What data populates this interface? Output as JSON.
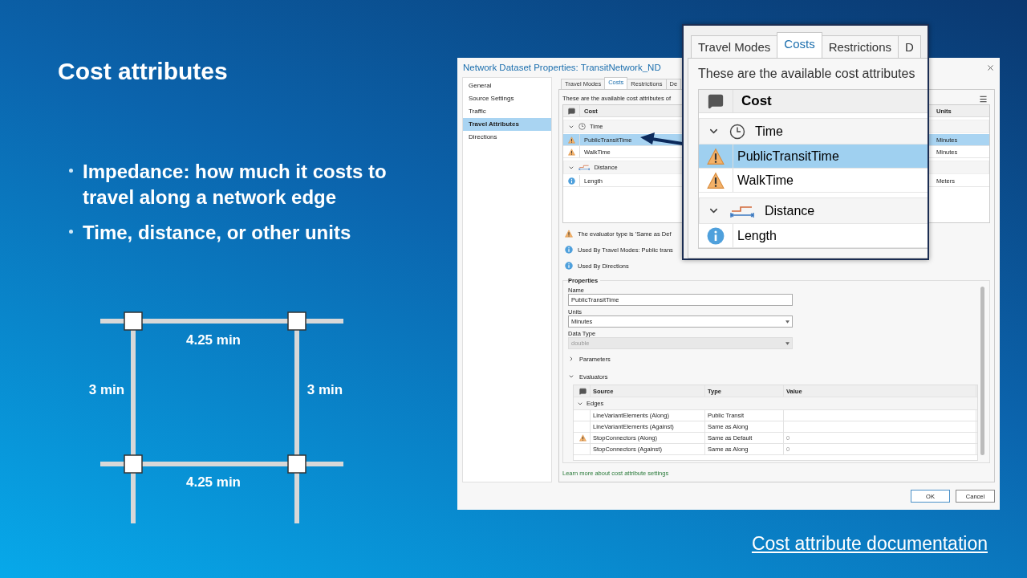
{
  "slide": {
    "title": "Cost attributes",
    "bullets": [
      "Impedance: how much it costs to travel along a network edge",
      "Time, distance, or other units"
    ],
    "diagram": {
      "edge_labels": [
        "4.25 min",
        "3 min",
        "3 min",
        "4.25 min"
      ]
    },
    "link": "Cost attribute documentation"
  },
  "dialog": {
    "title": "Network Dataset Properties: TransitNetwork_ND",
    "sidebar": [
      {
        "label": "General",
        "selected": false
      },
      {
        "label": "Source Settings",
        "selected": false
      },
      {
        "label": "Traffic",
        "selected": false
      },
      {
        "label": "Travel Attributes",
        "selected": true
      },
      {
        "label": "Directions",
        "selected": false
      }
    ],
    "tabs": [
      {
        "label": "Travel Modes",
        "selected": false
      },
      {
        "label": "Costs",
        "selected": true
      },
      {
        "label": "Restrictions",
        "selected": false
      },
      {
        "label": "De",
        "selected": false
      }
    ],
    "description": "These are the available cost attributes of",
    "cost_table": {
      "columns": [
        "Cost",
        "Units"
      ],
      "groups": [
        {
          "label": "Time",
          "kind": "time",
          "expanded": true,
          "rows": [
            {
              "name": "PublicTransitTime",
              "kind": "warning",
              "units": "Minutes",
              "selected": true
            },
            {
              "name": "WalkTime",
              "kind": "warning",
              "units": "Minutes",
              "selected": false
            }
          ]
        },
        {
          "label": "Distance",
          "kind": "distance",
          "expanded": true,
          "rows": [
            {
              "name": "Length",
              "kind": "info",
              "units": "Meters",
              "selected": false
            }
          ]
        }
      ]
    },
    "messages": [
      {
        "kind": "warning",
        "text": "The evaluator type is 'Same as Def"
      },
      {
        "kind": "info",
        "text": "Used By Travel Modes: Public trans"
      },
      {
        "kind": "info",
        "text": "Used By Directions"
      }
    ],
    "properties": {
      "legend": "Properties",
      "fields": [
        {
          "label": "Name",
          "kind": "text",
          "value": "PublicTransitTime",
          "disabled": false
        },
        {
          "label": "Units",
          "kind": "select",
          "value": "Minutes",
          "disabled": false
        },
        {
          "label": "Data Type",
          "kind": "select",
          "value": "double",
          "disabled": true
        }
      ],
      "sections": [
        {
          "label": "Parameters",
          "expanded": false
        },
        {
          "label": "Evaluators",
          "expanded": true
        }
      ],
      "evaluators": {
        "columns": [
          "Source",
          "Type",
          "Value"
        ],
        "group": {
          "label": "Edges",
          "expanded": true
        },
        "rows": [
          {
            "source": "LineVariantElements (Along)",
            "type": "Public Transit",
            "value": "",
            "warning": false
          },
          {
            "source": "LineVariantElements (Against)",
            "type": "Same as Along",
            "value": "",
            "warning": false
          },
          {
            "source": "StopConnectors (Along)",
            "type": "Same as Default",
            "value": "0",
            "warning": true
          },
          {
            "source": "StopConnectors (Against)",
            "type": "Same as Along",
            "value": "0",
            "warning": false
          }
        ]
      }
    },
    "link": "Learn more about cost attribute settings",
    "buttons": [
      "OK",
      "Cancel"
    ]
  },
  "inset": {
    "tabs": [
      {
        "label": "Travel Modes",
        "selected": false
      },
      {
        "label": "Costs",
        "selected": true
      },
      {
        "label": "Restrictions",
        "selected": false
      },
      {
        "label": "D",
        "selected": false
      }
    ],
    "description": "These are the available cost attributes",
    "column": "Cost",
    "groups": [
      {
        "label": "Time",
        "kind": "time",
        "expanded": true,
        "rows": [
          {
            "name": "PublicTransitTime",
            "kind": "warning",
            "selected": true
          },
          {
            "name": "WalkTime",
            "kind": "warning",
            "selected": false
          }
        ]
      },
      {
        "label": "Distance",
        "kind": "distance",
        "expanded": true,
        "rows": [
          {
            "name": "Length",
            "kind": "info",
            "selected": false
          }
        ]
      }
    ]
  }
}
